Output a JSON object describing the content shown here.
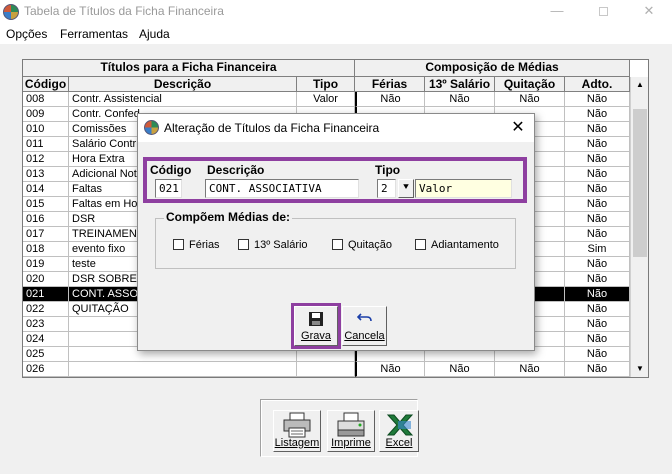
{
  "window": {
    "title": "Tabela de Títulos da Ficha Financeira",
    "minimize_glyph": "—",
    "close_glyph": "✕"
  },
  "menu": [
    {
      "label": "Opções"
    },
    {
      "label": "Ferramentas"
    },
    {
      "label": "Ajuda"
    }
  ],
  "grid": {
    "group_left": "Títulos para a Ficha Financeira",
    "group_right": "Composição de Médias",
    "columns": [
      "Código",
      "Descrição",
      "Tipo",
      "Férias",
      "13º Salário",
      "Quitação",
      "Adto."
    ],
    "rows": [
      {
        "codigo": "008",
        "descricao": "Contr. Assistencial",
        "tipo": "Valor",
        "ferias": "Não",
        "decimo": "Não",
        "quitacao": "Não",
        "adto": "Não"
      },
      {
        "codigo": "009",
        "descricao": "Contr. Confed",
        "tipo": "",
        "ferias": "",
        "decimo": "",
        "quitacao": "",
        "adto": "Não"
      },
      {
        "codigo": "010",
        "descricao": "Comissões",
        "tipo": "",
        "ferias": "",
        "decimo": "",
        "quitacao": "",
        "adto": "Não"
      },
      {
        "codigo": "011",
        "descricao": "Salário Contrib",
        "tipo": "",
        "ferias": "",
        "decimo": "",
        "quitacao": "",
        "adto": "Não"
      },
      {
        "codigo": "012",
        "descricao": "Hora Extra",
        "tipo": "",
        "ferias": "",
        "decimo": "",
        "quitacao": "",
        "adto": "Não"
      },
      {
        "codigo": "013",
        "descricao": "Adicional Notu",
        "tipo": "",
        "ferias": "",
        "decimo": "",
        "quitacao": "",
        "adto": "Não"
      },
      {
        "codigo": "014",
        "descricao": "Faltas",
        "tipo": "",
        "ferias": "",
        "decimo": "",
        "quitacao": "",
        "adto": "Não"
      },
      {
        "codigo": "015",
        "descricao": "Faltas em Hor",
        "tipo": "",
        "ferias": "",
        "decimo": "",
        "quitacao": "",
        "adto": "Não"
      },
      {
        "codigo": "016",
        "descricao": "DSR",
        "tipo": "",
        "ferias": "",
        "decimo": "",
        "quitacao": "",
        "adto": "Não"
      },
      {
        "codigo": "017",
        "descricao": "TREINAMENTO",
        "tipo": "",
        "ferias": "",
        "decimo": "",
        "quitacao": "",
        "adto": "Não"
      },
      {
        "codigo": "018",
        "descricao": "evento fixo",
        "tipo": "",
        "ferias": "",
        "decimo": "",
        "quitacao": "",
        "adto": "Sim"
      },
      {
        "codigo": "019",
        "descricao": "teste",
        "tipo": "",
        "ferias": "",
        "decimo": "",
        "quitacao": "",
        "adto": "Não"
      },
      {
        "codigo": "020",
        "descricao": "DSR SOBRE C",
        "tipo": "",
        "ferias": "",
        "decimo": "",
        "quitacao": "",
        "adto": "Não"
      },
      {
        "codigo": "021",
        "descricao": "CONT. ASSOC",
        "tipo": "",
        "ferias": "",
        "decimo": "",
        "quitacao": "",
        "adto": "Não"
      },
      {
        "codigo": "022",
        "descricao": "QUITAÇÃO",
        "tipo": "",
        "ferias": "",
        "decimo": "",
        "quitacao": "",
        "adto": "Não"
      },
      {
        "codigo": "023",
        "descricao": "",
        "tipo": "",
        "ferias": "",
        "decimo": "",
        "quitacao": "",
        "adto": "Não"
      },
      {
        "codigo": "024",
        "descricao": "",
        "tipo": "",
        "ferias": "",
        "decimo": "",
        "quitacao": "",
        "adto": "Não"
      },
      {
        "codigo": "025",
        "descricao": "",
        "tipo": "",
        "ferias": "",
        "decimo": "",
        "quitacao": "",
        "adto": "Não"
      },
      {
        "codigo": "026",
        "descricao": "",
        "tipo": "",
        "ferias": "Não",
        "decimo": "Não",
        "quitacao": "Não",
        "adto": "Não"
      }
    ],
    "selected_row": 13
  },
  "toolbar": {
    "listagem": "Listagem",
    "imprime": "Imprime",
    "excel": "Excel"
  },
  "dialog": {
    "title": "Alteração de Títulos da Ficha Financeira",
    "close_glyph": "✕",
    "codigo_label": "Código",
    "codigo_value": "021",
    "descricao_label": "Descrição",
    "descricao_value": "CONT. ASSOCIATIVA",
    "tipo_label": "Tipo",
    "tipo_value": "2",
    "tipo_text": "Valor",
    "group_title": "Compõem Médias de:",
    "checks": {
      "ferias": "Férias",
      "decimo": "13º Salário",
      "quitacao": "Quitação",
      "adiantamento": "Adiantamento"
    },
    "grava_label": "Grava",
    "cancela_label": "Cancela"
  },
  "colors": {
    "highlight": "#8e3fa0",
    "selected_row_bg": "#000000",
    "tipo_text_bg": "#ffffe1"
  },
  "icons": [
    "app-icon",
    "save-icon",
    "undo-icon",
    "printer-icon",
    "excel-icon",
    "dropdown-arrow-icon"
  ]
}
